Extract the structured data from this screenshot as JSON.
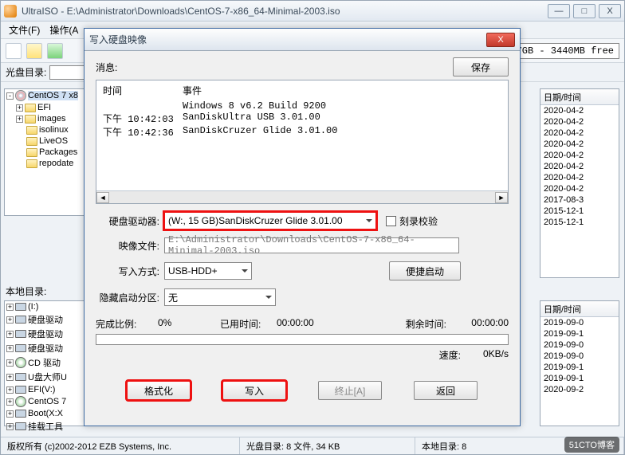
{
  "main": {
    "app_title": "UltraISO - E:\\Administrator\\Downloads\\CentOS-7-x86_64-Minimal-2003.iso",
    "menu": {
      "file": "文件(F)",
      "action": "操作(A"
    },
    "disc_free": "7GB - 3440MB free",
    "cd_dir_label": "光盘目录:",
    "local_dir_label": "本地目录:"
  },
  "tree": {
    "root": "CentOS 7 x8",
    "items": [
      "EFI",
      "images",
      "isolinux",
      "LiveOS",
      "Packages",
      "repodate"
    ]
  },
  "right_list": {
    "header": "日期/时间",
    "rows": [
      "2020-04-2",
      "2020-04-2",
      "2020-04-2",
      "2020-04-2",
      "2020-04-2",
      "2020-04-2",
      "2020-04-2",
      "2020-04-2",
      "2017-08-3",
      "2015-12-1",
      "2015-12-1"
    ]
  },
  "local_tree": {
    "items": [
      "(I:)",
      "硬盘驱动",
      "硬盘驱动",
      "硬盘驱动",
      "CD 驱动",
      "U盘大师U",
      "EFI(V:)",
      "CentOS 7",
      "Boot(X:X",
      "挂载工具"
    ]
  },
  "local_list": {
    "header": "日期/时间",
    "rows": [
      "2019-09-0",
      "2019-09-1",
      "2019-09-0",
      "2019-09-0",
      "2019-09-1",
      "2019-09-1",
      "2020-09-2"
    ]
  },
  "status": {
    "copyright": "版权所有 (c)2002-2012 EZB Systems, Inc.",
    "cd_dir": "光盘目录: 8 文件, 34 KB",
    "local_dir": "本地目录: 8",
    "watermark": "51CTO博客"
  },
  "dialog": {
    "title": "写入硬盘映像",
    "msg_label": "消息:",
    "save": "保存",
    "log": {
      "col_time": "时间",
      "col_event": "事件",
      "rows": [
        {
          "time": "",
          "event": "Windows 8 v6.2 Build 9200"
        },
        {
          "time": "下午 10:42:03",
          "event": "SanDiskUltra USB 3.01.00"
        },
        {
          "time": "下午 10:42:36",
          "event": "SanDiskCruzer Glide 3.01.00"
        }
      ]
    },
    "drive_label": "硬盘驱动器:",
    "drive_value": "(W:, 15 GB)SanDiskCruzer Glide 3.01.00",
    "verify_label": "刻录校验",
    "image_label": "映像文件:",
    "image_value": "E:\\Administrator\\Downloads\\CentOS-7-x86_64-Minimal-2003.iso",
    "write_mode_label": "写入方式:",
    "write_mode_value": "USB-HDD+",
    "easyboot": "便捷启动",
    "hidden_label": "隐藏启动分区:",
    "hidden_value": "无",
    "progress": {
      "done_label": "完成比例:",
      "done_value": "0%",
      "elapsed_label": "已用时间:",
      "elapsed_value": "00:00:00",
      "remain_label": "剩余时间:",
      "remain_value": "00:00:00",
      "speed_label": "速度:",
      "speed_value": "0KB/s"
    },
    "buttons": {
      "format": "格式化",
      "write": "写入",
      "abort": "终止[A]",
      "back": "返回"
    }
  }
}
